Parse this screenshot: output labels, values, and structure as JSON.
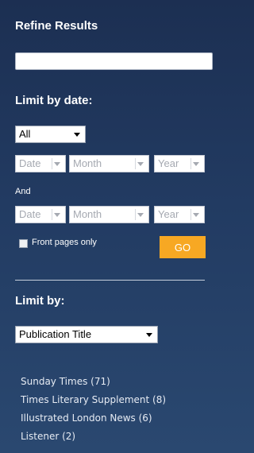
{
  "refine": {
    "heading": "Refine Results",
    "search_value": ""
  },
  "date_limit": {
    "heading": "Limit by date:",
    "range_select": "All",
    "from": {
      "date": "Date",
      "month": "Month",
      "year": "Year"
    },
    "and_label": "And",
    "to": {
      "date": "Date",
      "month": "Month",
      "year": "Year"
    },
    "front_pages_label": "Front pages only",
    "go_label": "GO"
  },
  "limit_by": {
    "heading": "Limit by:",
    "select": "Publication Title",
    "items": [
      {
        "label": "Sunday Times (71)"
      },
      {
        "label": "Times Literary Supplement (8)"
      },
      {
        "label": "Illustrated London News (6)"
      },
      {
        "label": "Listener (2)"
      }
    ]
  },
  "colors": {
    "background_top": "#1c2f52",
    "background_bottom": "#2a4870",
    "go_button": "#f7a823"
  }
}
